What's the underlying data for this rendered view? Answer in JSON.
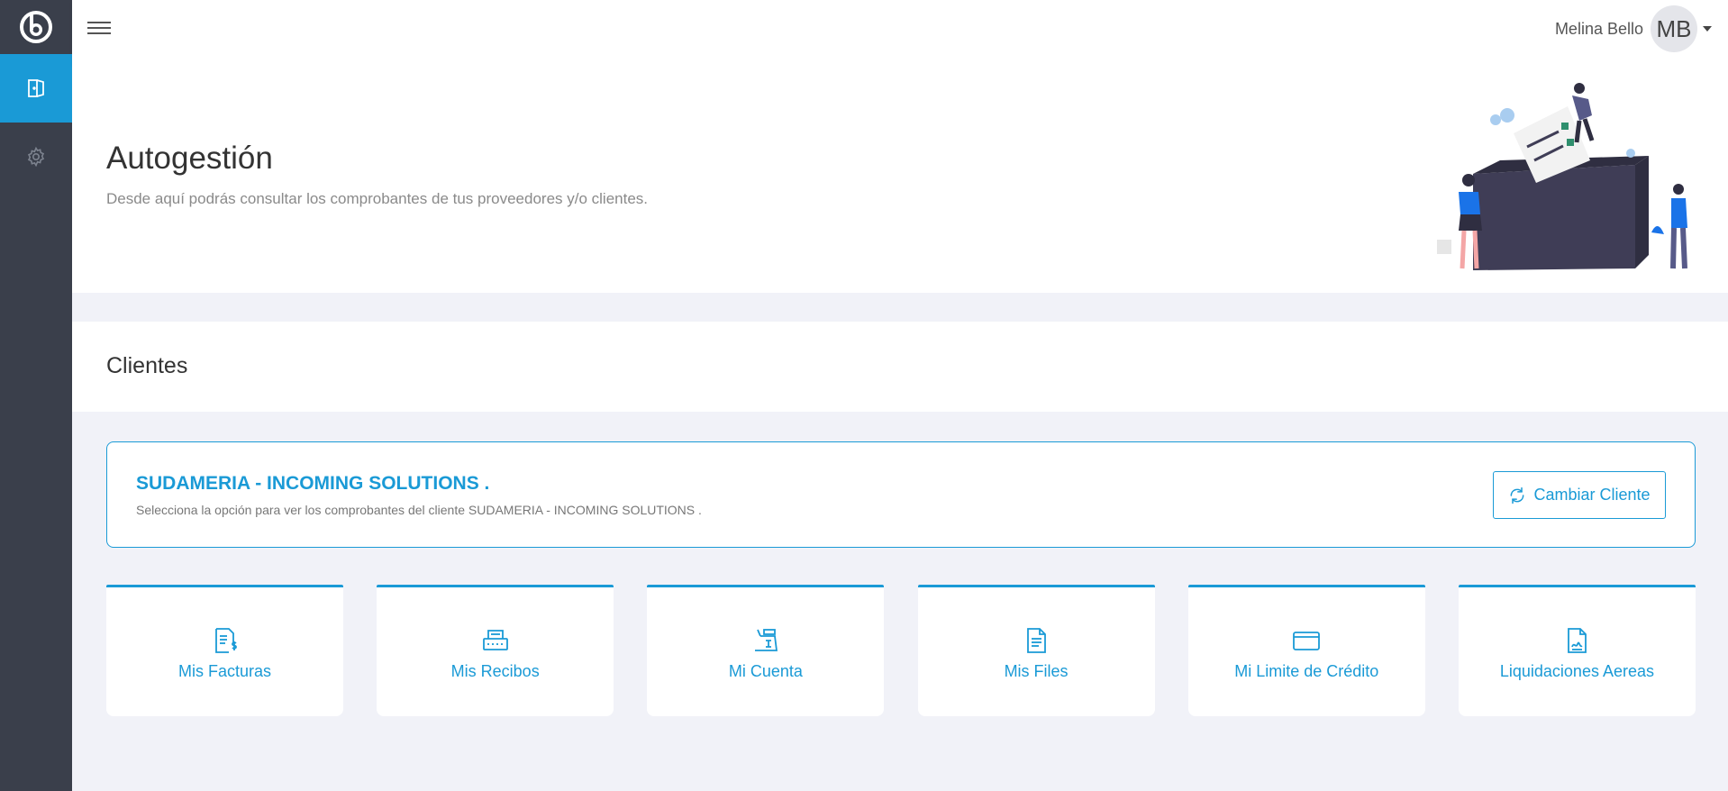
{
  "topbar": {
    "user_name": "Melina Bello",
    "avatar_initials": "MB"
  },
  "hero": {
    "title": "Autogestión",
    "subtitle": "Desde aquí podrás consultar los comprobantes de tus proveedores y/o clientes."
  },
  "section": {
    "title": "Clientes"
  },
  "client": {
    "name": "SUDAMERIA - INCOMING SOLUTIONS .",
    "description": "Selecciona la opción para ver los comprobantes del cliente SUDAMERIA - INCOMING SOLUTIONS .",
    "change_button": "Cambiar Cliente"
  },
  "tiles": [
    {
      "label": "Mis Facturas",
      "icon": "invoice-dollar-icon"
    },
    {
      "label": "Mis Recibos",
      "icon": "receipt-printer-icon"
    },
    {
      "label": "Mi Cuenta",
      "icon": "cash-register-icon"
    },
    {
      "label": "Mis Files",
      "icon": "document-icon"
    },
    {
      "label": "Mi Limite de Crédito",
      "icon": "credit-card-icon"
    },
    {
      "label": "Liquidaciones Aereas",
      "icon": "signed-document-icon"
    }
  ],
  "colors": {
    "accent": "#1a9ad6",
    "sidebar": "#3a3f4b",
    "background": "#f1f2f8"
  }
}
